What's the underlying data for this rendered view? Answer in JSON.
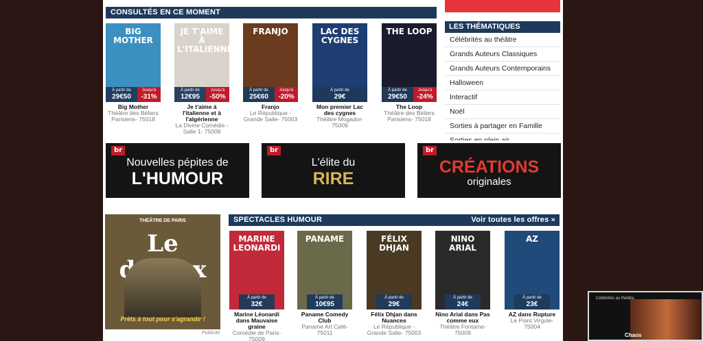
{
  "section_consultes": {
    "title": "Consultés en ce moment"
  },
  "consultes": [
    {
      "poster_text": "BIG MOTHER",
      "price_label": "À partir de",
      "price": "29€50",
      "discount_label": "Jusqu'à",
      "discount": "-31%",
      "name": "Big Mother",
      "venue": "Théâtre des Béliers Parisiens- 75018",
      "bg": "#3c8fc1"
    },
    {
      "poster_text": "JE T'AIME À L'ITALIENNE",
      "price_label": "À partir de",
      "price": "12€95",
      "discount_label": "Jusqu'à",
      "discount": "-50%",
      "name": "Je t'aime à l'italienne et à l'algérienne",
      "venue": "La Divine Comédie - Salle 1- 75009",
      "bg": "#d9d3cc"
    },
    {
      "poster_text": "FRANJO",
      "price_label": "À partir de",
      "price": "25€60",
      "discount_label": "Jusqu'à",
      "discount": "-20%",
      "name": "Franjo",
      "venue": "Le République - Grande Salle- 75003",
      "bg": "#6b3b1f"
    },
    {
      "poster_text": "LAC DES CYGNES",
      "price_label": "À partir de",
      "price": "29€",
      "discount_label": "",
      "discount": "",
      "name": "Mon premier Lac des cygnes",
      "venue": "Théâtre Mogador- 75009",
      "bg": "#1e3d72"
    },
    {
      "poster_text": "THE LOOP",
      "price_label": "À partir de",
      "price": "29€50",
      "discount_label": "Jusqu'à",
      "discount": "-24%",
      "name": "The Loop",
      "venue": "Théâtre des Béliers Parisiens- 75018",
      "bg": "#1b1b2e"
    }
  ],
  "banners": [
    {
      "logo": "br",
      "line1": "Nouvelles pépites de",
      "line2": "L'HUMOUR",
      "color2": "#ffffff"
    },
    {
      "logo": "br",
      "line1": "L'élite du",
      "line2": "RIRE",
      "color2": "#d9b45a"
    },
    {
      "logo": "br",
      "line1": "CRÉATIONS",
      "line2": "originales",
      "color2": "#e33b2e"
    }
  ],
  "sidebar": {
    "title": "Les thématiques",
    "items": [
      "Célébrités au théâtre",
      "Grands Auteurs Classiques",
      "Grands Auteurs Contemporains",
      "Halloween",
      "Interactif",
      "Noël",
      "Sorties à partager en Famille",
      "Sorties en plein air"
    ]
  },
  "section_humour": {
    "title": "Spectacles humour",
    "more": "Voir toutes les offres »"
  },
  "humour": [
    {
      "poster_text": "MARINE LEONARDI",
      "price_label": "À partir de",
      "price": "32€",
      "name": "Marine Léonardi dans Mauvaise graine",
      "venue": "Comédie de Paris- 75009",
      "bg": "#c22a3a"
    },
    {
      "poster_text": "PANAME",
      "price_label": "À partir de",
      "price": "10€95",
      "name": "Paname Comedy Club",
      "venue": "Paname Art Café- 75011",
      "bg": "#6a6a4a"
    },
    {
      "poster_text": "FÉLIX DHJAN",
      "price_label": "À partir de",
      "price": "29€",
      "name": "Félix Dhjan dans Nuances",
      "venue": "Le République - Grande Salle- 75003",
      "bg": "#4a3a24"
    },
    {
      "poster_text": "NINO ARIAL",
      "price_label": "À partir de",
      "price": "24€",
      "name": "Nino Arial dans Pas comme eux",
      "venue": "Théâtre Fontaine- 75009",
      "bg": "#2a2a2a"
    },
    {
      "poster_text": "AZ",
      "price_label": "À partir de",
      "price": "23€",
      "name": "AZ dans Rupture",
      "venue": "Le Point Virgule- 75004",
      "bg": "#1f4a7a"
    }
  ],
  "ad": {
    "top": "THÉÂTRE DE PARIS",
    "title": "Le duplex",
    "tagline": "Prêts à tout pour s'agrandir !",
    "caption": "Publicité"
  },
  "video": {
    "text": "Célébrités au théâtre",
    "badge": "Chaos"
  }
}
